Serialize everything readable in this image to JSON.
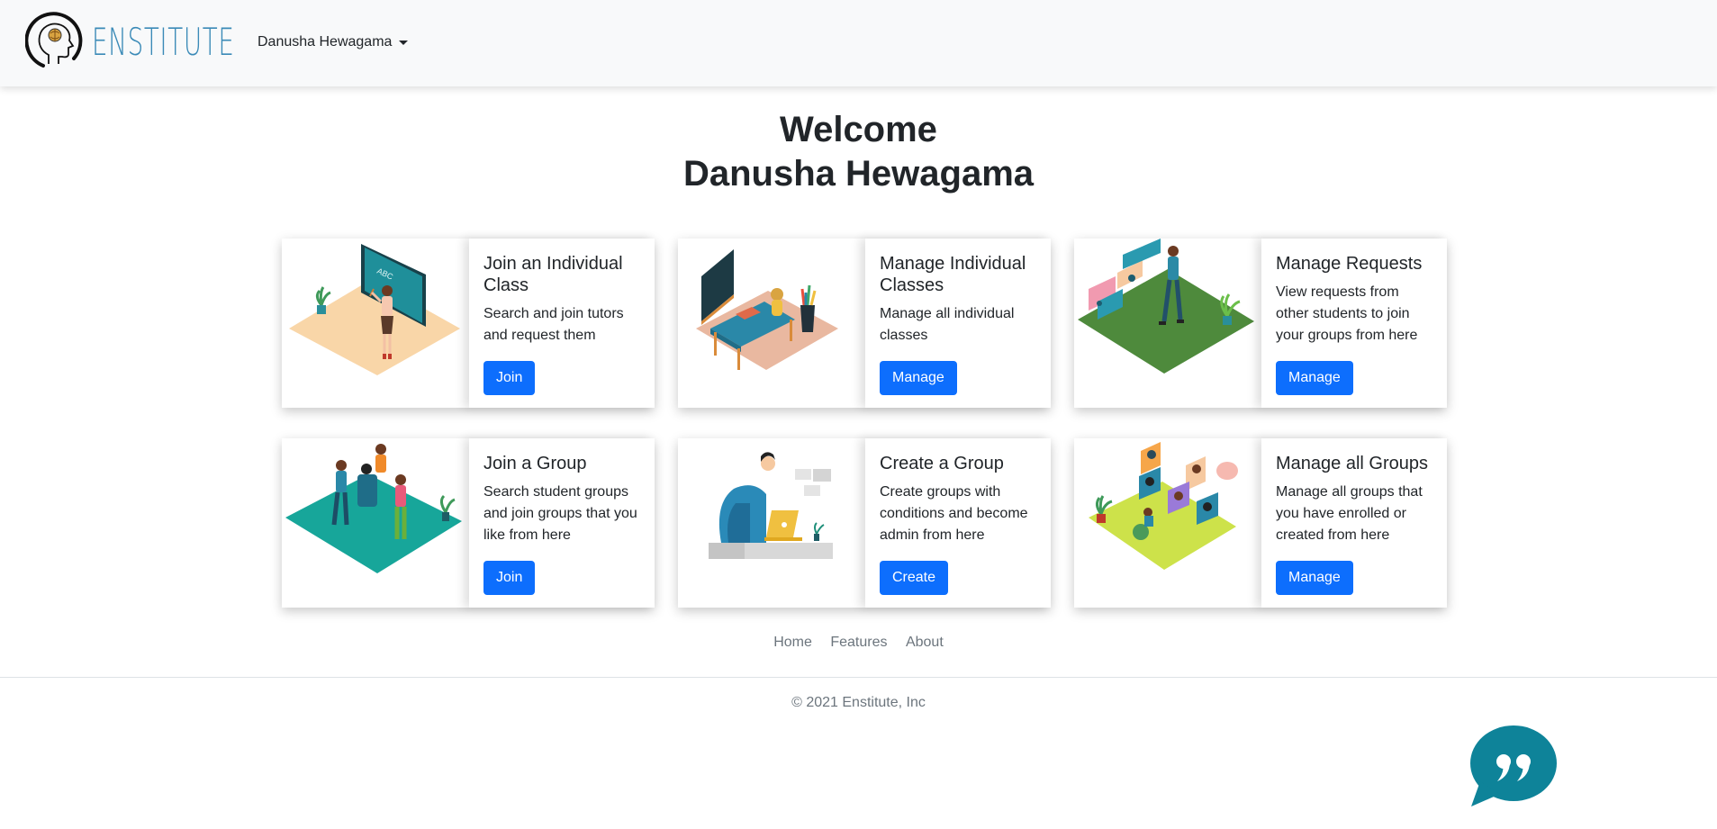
{
  "header": {
    "logo_text": "ENSTITUTE",
    "user_name": "Danusha Hewagama"
  },
  "welcome": {
    "line1": "Welcome",
    "line2": "Danusha Hewagama"
  },
  "cards": [
    {
      "title": "Join an Individual Class",
      "text": "Search and join tutors and request them",
      "button": "Join",
      "illustration": "teacher-blackboard-illustration"
    },
    {
      "title": "Manage Individual Classes",
      "text": "Manage all individual classes",
      "button": "Manage",
      "illustration": "student-desk-illustration"
    },
    {
      "title": "Manage Requests",
      "text": "View requests from other students to join your groups from here",
      "button": "Manage",
      "illustration": "requests-illustration"
    },
    {
      "title": "Join a Group",
      "text": "Search student groups and join groups that you like from here",
      "button": "Join",
      "illustration": "group-meeting-illustration"
    },
    {
      "title": "Create a Group",
      "text": "Create groups with conditions and become admin from here",
      "button": "Create",
      "illustration": "laptop-user-illustration"
    },
    {
      "title": "Manage all Groups",
      "text": "Manage all groups that you have enrolled or created from here",
      "button": "Manage",
      "illustration": "video-call-illustration"
    }
  ],
  "footer": {
    "links": [
      "Home",
      "Features",
      "About"
    ],
    "copyright": "© 2021 Enstitute, Inc"
  },
  "colors": {
    "primary": "#0d6efd",
    "chat_bubble": "#0e8399",
    "logo_text": "#3a8ab7"
  }
}
